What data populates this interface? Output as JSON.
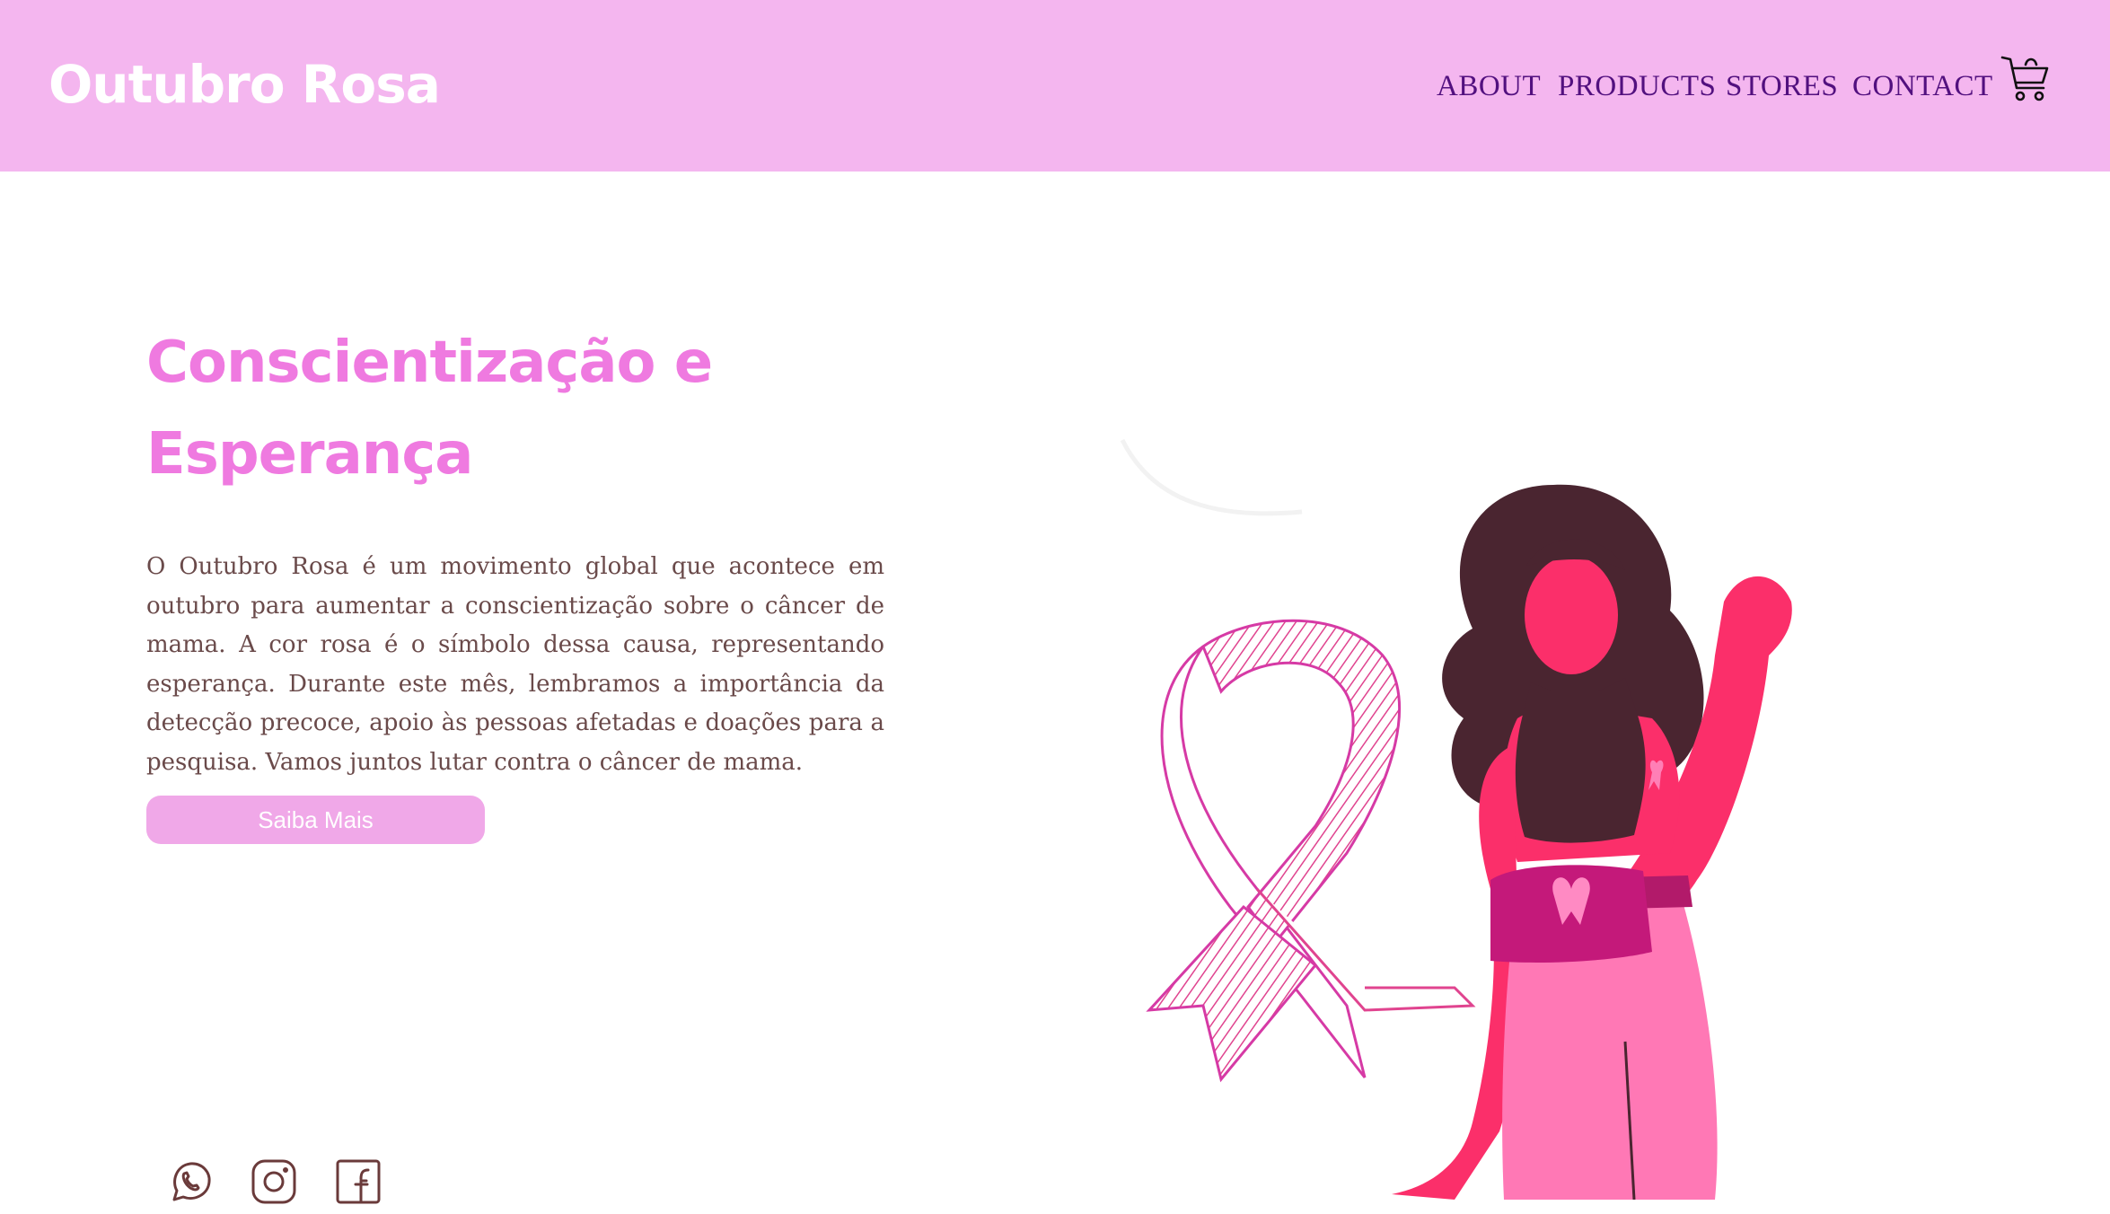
{
  "header": {
    "brand": "Outubro Rosa",
    "nav": [
      {
        "label": "ABOUT"
      },
      {
        "label": "PRODUCTS"
      },
      {
        "label": "STORES"
      },
      {
        "label": "CONTACT"
      }
    ],
    "cart_icon": "shopping-cart-icon"
  },
  "hero": {
    "title": "Conscientização e Esperança",
    "description": "O Outubro Rosa é um movimento global que acontece em outubro para aumentar a conscientização sobre o câncer de mama. A cor rosa é o símbolo dessa causa, representando esperança. Durante este mês, lembramos a importância da detecção precoce, apoio às pessoas afetadas e doações para a pesquisa. Vamos juntos lutar contra o câncer de mama.",
    "cta_label": "Saiba Mais"
  },
  "social": [
    {
      "icon": "whatsapp-icon"
    },
    {
      "icon": "instagram-icon"
    },
    {
      "icon": "facebook-icon"
    }
  ],
  "colors": {
    "header_bg": "#f4b6ef",
    "brand_text": "#ffffff",
    "nav_text": "#52107f",
    "title": "#ef7ae0",
    "body_text": "#6a4a4a",
    "button_bg": "#f0a8e8",
    "accent_pink": "#fb2f6a"
  }
}
